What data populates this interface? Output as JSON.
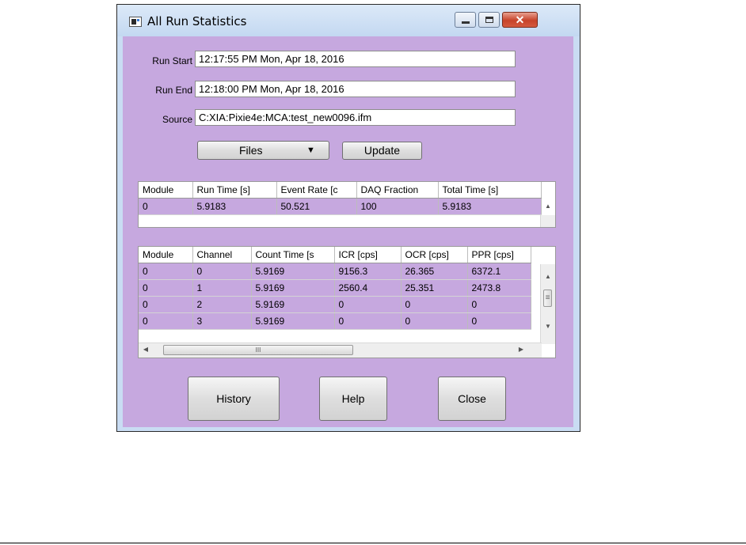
{
  "window": {
    "title": "All Run Statistics",
    "minimize_glyph": "",
    "maximize_glyph": "",
    "close_glyph": "✕"
  },
  "fields": {
    "run_start": {
      "label": "Run Start",
      "value": "12:17:55 PM Mon, Apr 18, 2016"
    },
    "run_end": {
      "label": "Run End",
      "value": "12:18:00 PM Mon, Apr 18, 2016"
    },
    "source": {
      "label": "Source",
      "value": "C:XIA:Pixie4e:MCA:test_new0096.ifm"
    }
  },
  "buttons": {
    "files": "Files",
    "files_arrow": "▼",
    "update": "Update",
    "history": "History",
    "help": "Help",
    "close": "Close"
  },
  "module_table": {
    "headers": [
      "Module",
      "Run Time [s]",
      "Event Rate [c",
      "DAQ Fraction",
      "Total Time [s]"
    ],
    "rows": [
      [
        "0",
        "5.9183",
        "50.521",
        "100",
        "5.9183"
      ]
    ]
  },
  "channel_table": {
    "headers": [
      "Module",
      "Channel",
      "Count Time [s",
      "ICR [cps]",
      "OCR [cps]",
      "PPR [cps]"
    ],
    "rows": [
      [
        "0",
        "0",
        "5.9169",
        "9156.3",
        "26.365",
        "6372.1"
      ],
      [
        "0",
        "1",
        "5.9169",
        "2560.4",
        "25.351",
        "2473.8"
      ],
      [
        "0",
        "2",
        "5.9169",
        "0",
        "0",
        "0"
      ],
      [
        "0",
        "3",
        "5.9169",
        "0",
        "0",
        "0"
      ]
    ],
    "hscroll_grip": "III"
  },
  "scroll_glyphs": {
    "up": "▲",
    "down": "▼",
    "left": "◀",
    "right": "▶",
    "grip": "≡"
  },
  "colors": {
    "client_bg": "#c6a8df",
    "close_button": "#c7432a"
  }
}
